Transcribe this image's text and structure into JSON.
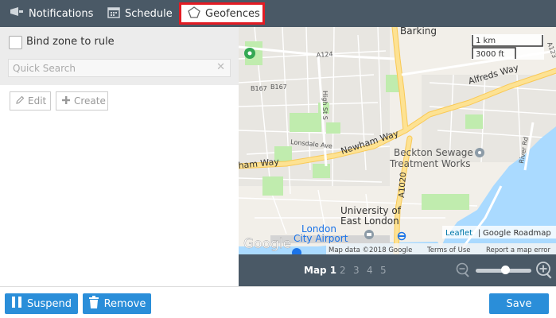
{
  "tabs": {
    "notifications": "Notifications",
    "schedule": "Schedule",
    "geofences": "Geofences"
  },
  "left_panel": {
    "bind_label": "Bind zone to rule",
    "search_placeholder": "Quick Search",
    "edit_label": "Edit",
    "create_label": "Create"
  },
  "map": {
    "places": {
      "barking": "Barking",
      "beckton_1": "Beckton Sewage",
      "beckton_2": "Treatment Works",
      "uel_1": "University of",
      "uel_2": "East London",
      "airport_1": "London",
      "airport_2": "City Airport"
    },
    "roads": {
      "alfreds": "Alfreds Way",
      "newham": "Newham Way",
      "newham_west": "ham Way",
      "a124": "A124",
      "b167a": "B167",
      "b167b": "B167",
      "highst": "High St S",
      "lonsdale": "Lonsdale Ave",
      "a1020": "A1020",
      "river": "River Rd",
      "a123": "A123"
    },
    "scale": {
      "metric": "1 km",
      "imperial": "3000 ft"
    },
    "attribution": {
      "leaflet": "Leaflet",
      "sep": "|",
      "roadmap": "Google Roadmap",
      "mapdata": "Map data ©2018 Google",
      "terms": "Terms of Use",
      "report": "Report a map error"
    },
    "logo": "Google"
  },
  "pager": {
    "pages": [
      "Map 1",
      "2",
      "3",
      "4",
      "5"
    ],
    "zoom_level": 0.55
  },
  "bottom": {
    "suspend": "Suspend",
    "remove": "Remove",
    "save": "Save"
  },
  "colors": {
    "header_bg": "#4a5966",
    "accent_blue": "#2a8ed9",
    "highlight_red": "#e31b23",
    "road_yellow": "#fde293",
    "water": "#aadaff",
    "park": "#c0ecae"
  }
}
